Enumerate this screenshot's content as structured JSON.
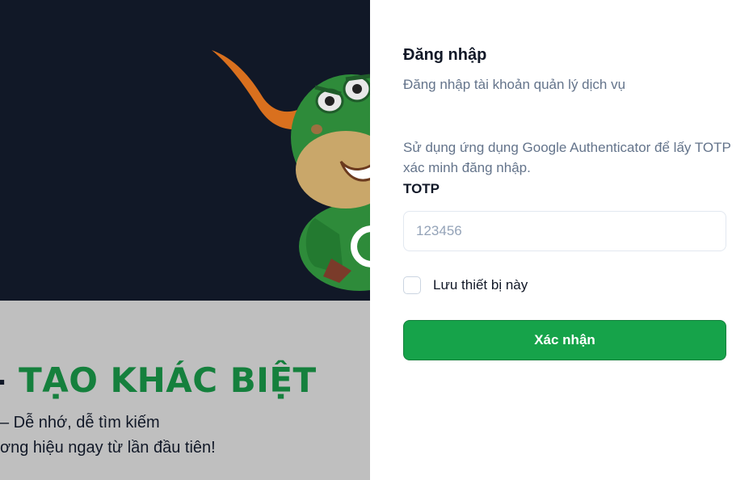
{
  "promo": {
    "headline_prefix": "-",
    "headline": "TẠO KHÁC BIỆT",
    "line1": "– Dễ nhớ, dễ tìm kiếm",
    "line2": "ơng hiệu ngay từ lần đầu tiên!"
  },
  "mascot": {
    "icon": "green-dragon-mascot"
  },
  "login": {
    "title": "Đăng nhập",
    "subtitle": "Đăng nhập tài khoản quản lý dịch vụ",
    "totp_help": "Sử dụng ứng dụng Google Authenticator để lấy TOTP xác minh đăng nhập.",
    "totp_label": "TOTP",
    "totp_value": "",
    "totp_placeholder": "123456",
    "remember_label": "Lưu thiết bị này",
    "remember_checked": false,
    "submit_label": "Xác nhận"
  },
  "colors": {
    "hero_dark": "#111827",
    "hero_light": "#bfbfbf",
    "brand_green": "#16a34a",
    "headline_green": "#15803d",
    "muted_text": "#64748b"
  }
}
